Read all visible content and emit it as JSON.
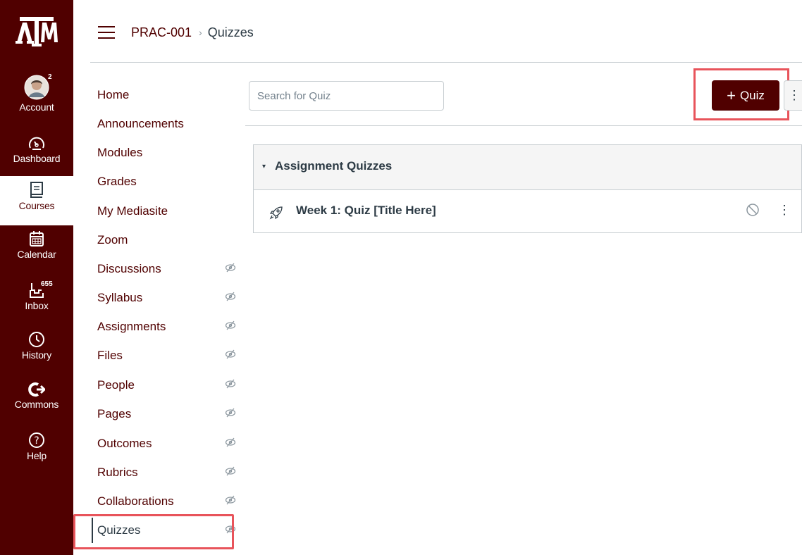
{
  "global_nav": {
    "logo": "ATM",
    "items": [
      {
        "label": "Account",
        "icon": "avatar-icon",
        "badge": "2"
      },
      {
        "label": "Dashboard",
        "icon": "speedometer-icon"
      },
      {
        "label": "Courses",
        "icon": "book-icon"
      },
      {
        "label": "Calendar",
        "icon": "calendar-icon"
      },
      {
        "label": "Inbox",
        "icon": "inbox-icon",
        "badge": "655"
      },
      {
        "label": "History",
        "icon": "clock-icon"
      },
      {
        "label": "Commons",
        "icon": "commons-arrow-icon"
      },
      {
        "label": "Help",
        "icon": "question-icon"
      }
    ]
  },
  "header": {
    "course": "PRAC-001",
    "separator": "›",
    "page": "Quizzes"
  },
  "course_nav": {
    "items": [
      {
        "label": "Home",
        "hidden": false
      },
      {
        "label": "Announcements",
        "hidden": false
      },
      {
        "label": "Modules",
        "hidden": false
      },
      {
        "label": "Grades",
        "hidden": false
      },
      {
        "label": "My Mediasite",
        "hidden": false
      },
      {
        "label": "Zoom",
        "hidden": false
      },
      {
        "label": "Discussions",
        "hidden": true
      },
      {
        "label": "Syllabus",
        "hidden": true
      },
      {
        "label": "Assignments",
        "hidden": true
      },
      {
        "label": "Files",
        "hidden": true
      },
      {
        "label": "People",
        "hidden": true
      },
      {
        "label": "Pages",
        "hidden": true
      },
      {
        "label": "Outcomes",
        "hidden": true
      },
      {
        "label": "Rubrics",
        "hidden": true
      },
      {
        "label": "Collaborations",
        "hidden": true
      },
      {
        "label": "Quizzes",
        "hidden": true,
        "active": true
      }
    ]
  },
  "toolbar": {
    "search_placeholder": "Search for Quiz",
    "add_plus": "+",
    "add_label": "Quiz",
    "more_icon": "⋮"
  },
  "quiz_group": {
    "caret": "▾",
    "title": "Assignment Quizzes",
    "items": [
      {
        "title": "Week 1: Quiz [Title Here]",
        "status_icon": "unpublished-icon",
        "more_icon": "⋮"
      }
    ]
  },
  "colors": {
    "brand": "#500000",
    "highlight": "#e8545b"
  }
}
